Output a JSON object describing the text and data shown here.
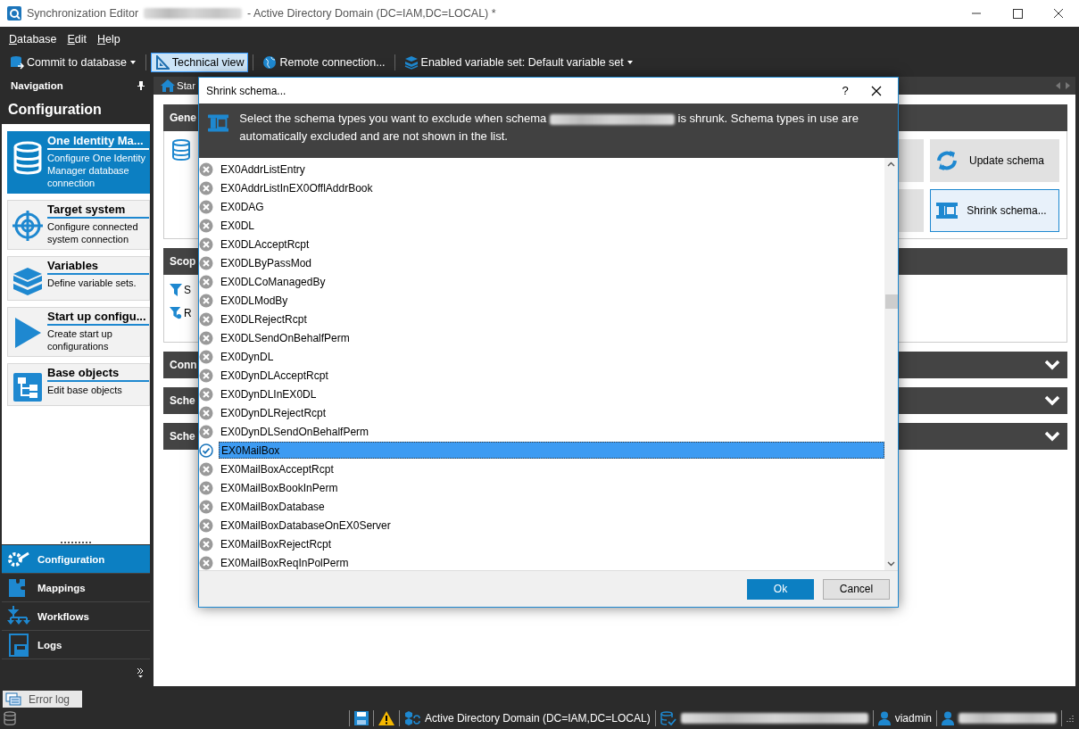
{
  "window": {
    "app_title": "Synchronization Editor",
    "title_suffix": "- Active Directory Domain (DC=IAM,DC=LOCAL) *"
  },
  "menu": [
    {
      "label": "Database"
    },
    {
      "label": "Edit"
    },
    {
      "label": "Help"
    }
  ],
  "toolbar": [
    {
      "label": "Commit to database",
      "kind": "dropdown",
      "selected": false
    },
    {
      "label": "Technical view",
      "kind": "toggle",
      "selected": true
    },
    {
      "label": "Remote connection...",
      "kind": "button",
      "selected": false
    },
    {
      "label": "Enabled variable set: Default variable set",
      "kind": "dropdown",
      "selected": false
    }
  ],
  "navigation": {
    "title": "Navigation",
    "section": "Configuration",
    "items": [
      {
        "title": "One Identity Ma...",
        "description": "Configure One Identity Manager database connection",
        "selected": true
      },
      {
        "title": "Target system",
        "description": "Configure connected system connection",
        "selected": false
      },
      {
        "title": "Variables",
        "description": "Define variable sets.",
        "selected": false
      },
      {
        "title": "Start up configu...",
        "description": "Create start up configurations",
        "selected": false
      },
      {
        "title": "Base objects",
        "description": "Edit base objects",
        "selected": false
      }
    ],
    "modules": [
      {
        "label": "Configuration",
        "selected": true
      },
      {
        "label": "Mappings",
        "selected": false
      },
      {
        "label": "Workflows",
        "selected": false
      },
      {
        "label": "Logs",
        "selected": false
      }
    ]
  },
  "main": {
    "tab": "Star",
    "sections": [
      {
        "title": "Gene",
        "expanded": true
      },
      {
        "title": "Scop",
        "expanded": true,
        "items": [
          "S",
          "R"
        ]
      },
      {
        "title": "Conn",
        "expanded": false
      },
      {
        "title": "Sche",
        "expanded": false
      },
      {
        "title": "Sche",
        "expanded": false
      }
    ],
    "actions": [
      {
        "label": "Update schema",
        "selected": false
      },
      {
        "label": "Shrink schema...",
        "selected": true
      }
    ]
  },
  "dialog": {
    "title": "Shrink schema...",
    "help": "?",
    "message_before": "Select the schema types you want to exclude when schema",
    "message_after": "is shrunk. Schema types in use are automatically excluded and are not shown in the list.",
    "items": [
      {
        "name": "EX0AddrListEntry",
        "checked": false,
        "selected": false
      },
      {
        "name": "EX0AddrListInEX0OfflAddrBook",
        "checked": false,
        "selected": false
      },
      {
        "name": "EX0DAG",
        "checked": false,
        "selected": false
      },
      {
        "name": "EX0DL",
        "checked": false,
        "selected": false
      },
      {
        "name": "EX0DLAcceptRcpt",
        "checked": false,
        "selected": false
      },
      {
        "name": "EX0DLByPassMod",
        "checked": false,
        "selected": false
      },
      {
        "name": "EX0DLCoManagedBy",
        "checked": false,
        "selected": false
      },
      {
        "name": "EX0DLModBy",
        "checked": false,
        "selected": false
      },
      {
        "name": "EX0DLRejectRcpt",
        "checked": false,
        "selected": false
      },
      {
        "name": "EX0DLSendOnBehalfPerm",
        "checked": false,
        "selected": false
      },
      {
        "name": "EX0DynDL",
        "checked": false,
        "selected": false
      },
      {
        "name": "EX0DynDLAcceptRcpt",
        "checked": false,
        "selected": false
      },
      {
        "name": "EX0DynDLInEX0DL",
        "checked": false,
        "selected": false
      },
      {
        "name": "EX0DynDLRejectRcpt",
        "checked": false,
        "selected": false
      },
      {
        "name": "EX0DynDLSendOnBehalfPerm",
        "checked": false,
        "selected": false
      },
      {
        "name": "EX0MailBox",
        "checked": true,
        "selected": true
      },
      {
        "name": "EX0MailBoxAcceptRcpt",
        "checked": false,
        "selected": false
      },
      {
        "name": "EX0MailBoxBookInPerm",
        "checked": false,
        "selected": false
      },
      {
        "name": "EX0MailBoxDatabase",
        "checked": false,
        "selected": false
      },
      {
        "name": "EX0MailBoxDatabaseOnEX0Server",
        "checked": false,
        "selected": false
      },
      {
        "name": "EX0MailBoxRejectRcpt",
        "checked": false,
        "selected": false
      },
      {
        "name": "EX0MailBoxReqInPolPerm",
        "checked": false,
        "selected": false
      }
    ],
    "buttons": [
      {
        "label": "Ok",
        "kind": "primary"
      },
      {
        "label": "Cancel",
        "kind": "secondary"
      }
    ]
  },
  "error_log_tab": "Error log",
  "status_bar": {
    "connection": "Active Directory Domain (DC=IAM,DC=LOCAL)",
    "user": "viadmin"
  }
}
